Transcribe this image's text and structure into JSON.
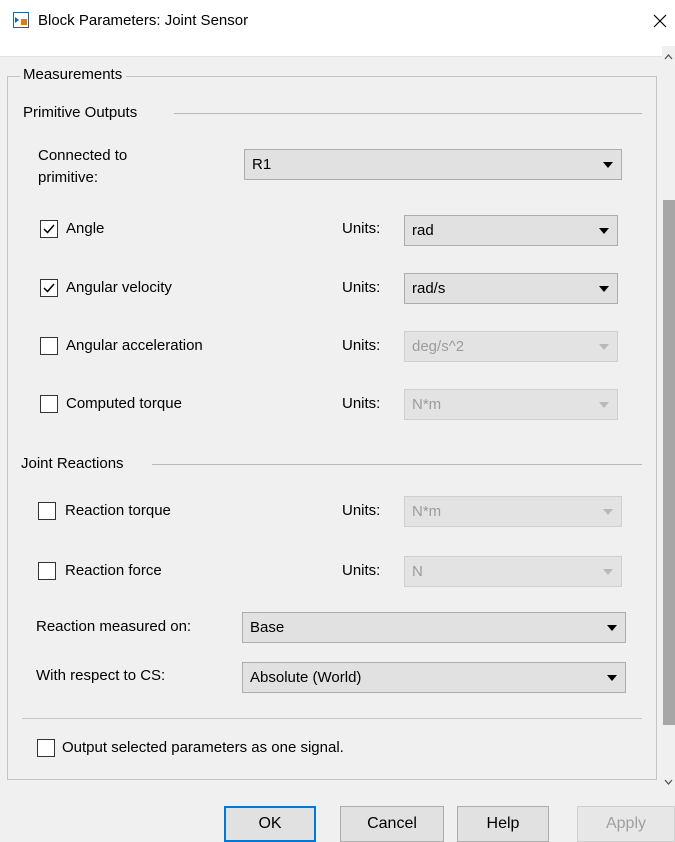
{
  "window": {
    "title": "Block Parameters: Joint Sensor"
  },
  "measurements": {
    "section_label": "Measurements",
    "primitive_outputs": {
      "group_label": "Primitive Outputs",
      "connected_label_line1": "Connected to",
      "connected_label_line2": "primitive:",
      "connected_value": "R1",
      "rows": [
        {
          "label": "Angle",
          "checked": true,
          "units_label": "Units:",
          "units": "rad",
          "enabled": true
        },
        {
          "label": "Angular velocity",
          "checked": true,
          "units_label": "Units:",
          "units": "rad/s",
          "enabled": true
        },
        {
          "label": "Angular acceleration",
          "checked": false,
          "units_label": "Units:",
          "units": "deg/s^2",
          "enabled": false
        },
        {
          "label": "Computed torque",
          "checked": false,
          "units_label": "Units:",
          "units": "N*m",
          "enabled": false
        }
      ]
    },
    "joint_reactions": {
      "group_label": "Joint Reactions",
      "rows": [
        {
          "label": "Reaction torque",
          "checked": false,
          "units_label": "Units:",
          "units": "N*m",
          "enabled": false
        },
        {
          "label": "Reaction force",
          "checked": false,
          "units_label": "Units:",
          "units": "N",
          "enabled": false
        }
      ],
      "measured_on_label": "Reaction measured on:",
      "measured_on_value": "Base",
      "respect_to_label": "With respect to CS:",
      "respect_to_value": "Absolute (World)"
    }
  },
  "output_signal": {
    "label": "Output selected parameters as one signal.",
    "checked": false
  },
  "buttons": {
    "ok": "OK",
    "cancel": "Cancel",
    "help": "Help",
    "apply": "Apply"
  },
  "icons": {
    "app": "simulink-block-icon",
    "close": "close-icon"
  }
}
